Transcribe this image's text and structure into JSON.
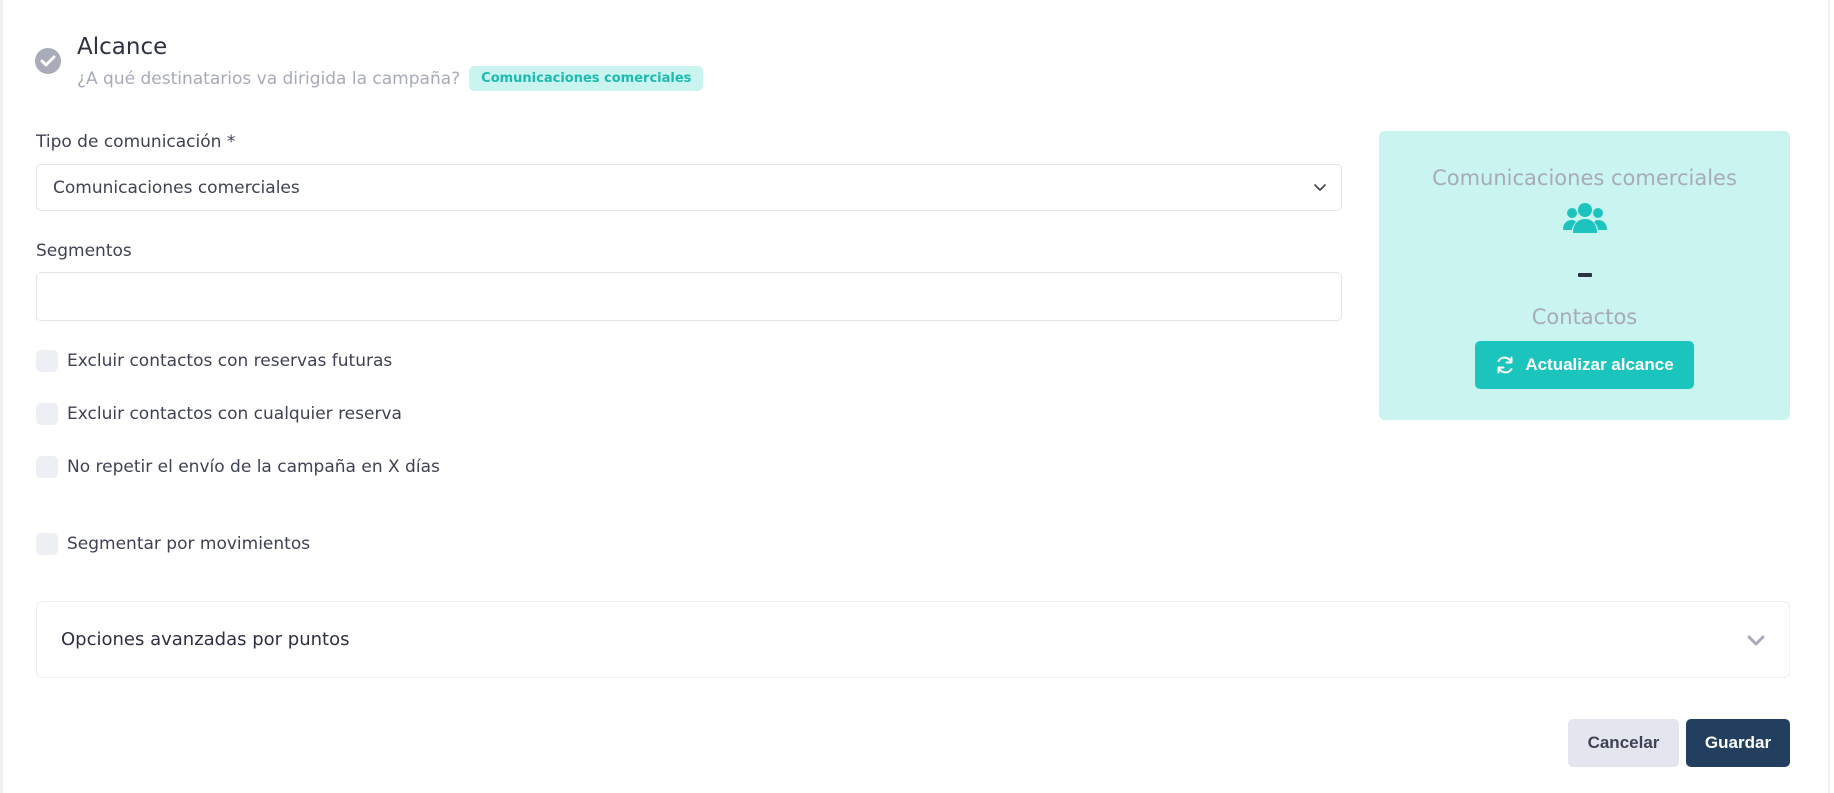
{
  "header": {
    "title": "Alcance",
    "subtitle": "¿A qué destinatarios va dirigida la campaña?",
    "badge": "Comunicaciones comerciales"
  },
  "form": {
    "tipo_label": "Tipo de comunicación *",
    "tipo_value": "Comunicaciones comerciales",
    "segmentos_label": "Segmentos",
    "segmentos_value": "",
    "checkboxes": [
      {
        "label": "Excluir contactos con reservas futuras",
        "checked": false
      },
      {
        "label": "Excluir contactos con cualquier reserva",
        "checked": false
      },
      {
        "label": "No repetir el envío de la campaña en X días",
        "checked": false
      },
      {
        "label": "Segmentar por movimientos",
        "checked": false
      }
    ]
  },
  "card": {
    "title": "Comunicaciones comerciales",
    "icon": "users-icon",
    "count": "-",
    "subtitle": "Contactos",
    "button_label": "Actualizar alcance"
  },
  "accordion": {
    "title": "Opciones avanzadas por puntos"
  },
  "footer": {
    "cancel_label": "Cancelar",
    "save_label": "Guardar"
  },
  "colors": {
    "accent": "#1bc5bd",
    "card_bg": "#c9f4f0",
    "primary": "#223f5f",
    "muted": "#a7aab9"
  }
}
